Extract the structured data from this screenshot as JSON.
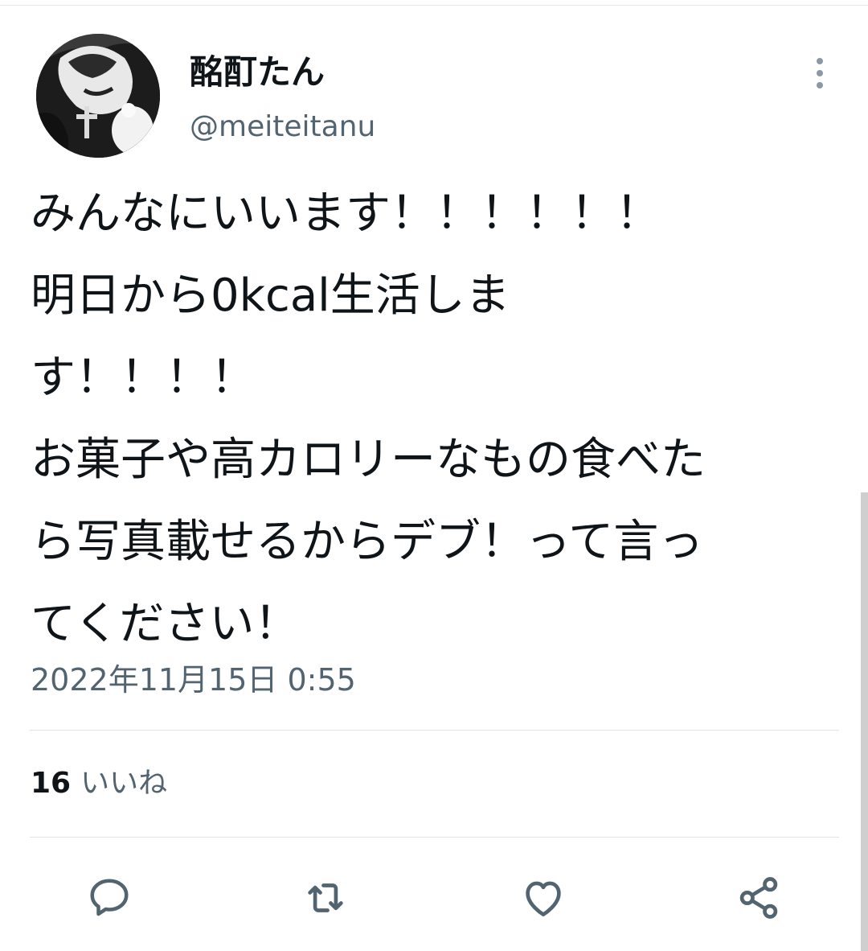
{
  "tweet": {
    "author": {
      "display_name": "酩酊たん",
      "handle": "@meiteitanu"
    },
    "text_lines": [
      "みんなにいいます！！！！！！",
      "明日から0kcal生活しま",
      "す！！！！",
      "お菓子や高カロリーなもの食べた",
      "ら写真載せるからデブ！って言っ",
      "てください！"
    ],
    "timestamp": "2022年11月15日 0:55",
    "stats": {
      "likes_count": "16",
      "likes_label": "いいね"
    },
    "actions": {
      "reply_icon": "reply-icon",
      "retweet_icon": "retweet-icon",
      "like_icon": "heart-icon",
      "share_icon": "share-icon"
    },
    "colors": {
      "text_primary": "#0f1419",
      "text_secondary": "#536471",
      "icon_gray": "#536471",
      "divider": "#e1e4e6"
    }
  }
}
